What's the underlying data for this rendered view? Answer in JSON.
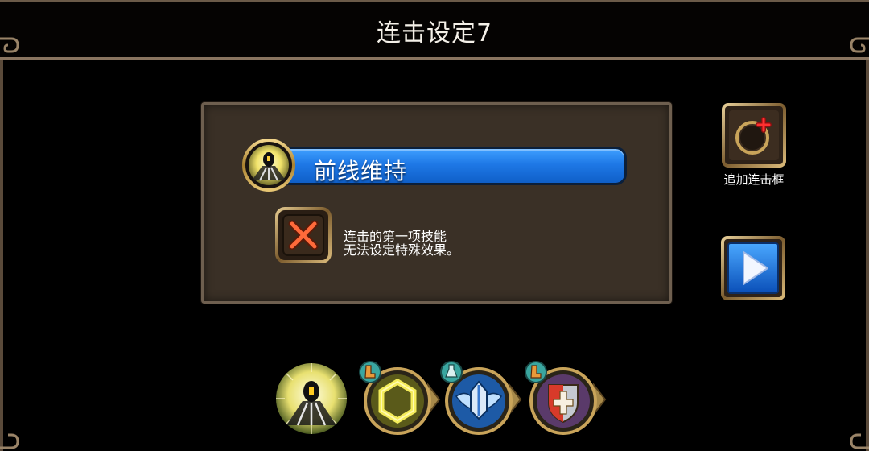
{
  "header": {
    "title": "连击设定7"
  },
  "panel": {
    "skill_name": "前线维持",
    "notice_line1": "连击的第一项技能",
    "notice_line2": "无法设定特殊效果。"
  },
  "actions": {
    "add_combo_label": "追加连击框",
    "add_icon": "plus-icon",
    "play_icon": "play-icon"
  },
  "chain_skills": [
    {
      "icon": "glowing-figure-skill-icon"
    },
    {
      "icon": "hexagon-skill-icon",
      "badge": "boot-badge-icon"
    },
    {
      "icon": "winged-shield-skill-icon",
      "badge": "flask-badge-icon"
    },
    {
      "icon": "cross-shield-skill-icon",
      "badge": "boot-badge-icon"
    }
  ],
  "colors": {
    "panel_bg": "#3a3026",
    "name_bar_blue": "#1e78e6",
    "gold_trim": "#c9a45a",
    "disabled_red": "#e8502a"
  }
}
